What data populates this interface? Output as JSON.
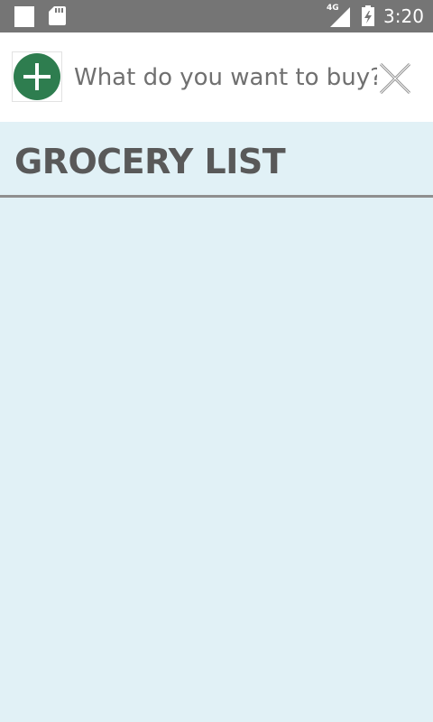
{
  "status_bar": {
    "network": "4G",
    "time": "3:20"
  },
  "search": {
    "placeholder": "What do you want to buy?",
    "value": ""
  },
  "list": {
    "title": "GROCERY LIST",
    "items": []
  },
  "colors": {
    "status_bar": "#757575",
    "background": "#e1f1f6",
    "add_button": "#2e7d4f",
    "title_text": "#595959"
  },
  "icons": {
    "add": "add-circle-icon",
    "clear": "close-icon",
    "sd_card": "sd-card-icon",
    "signal": "signal-icon",
    "battery": "battery-icon"
  }
}
